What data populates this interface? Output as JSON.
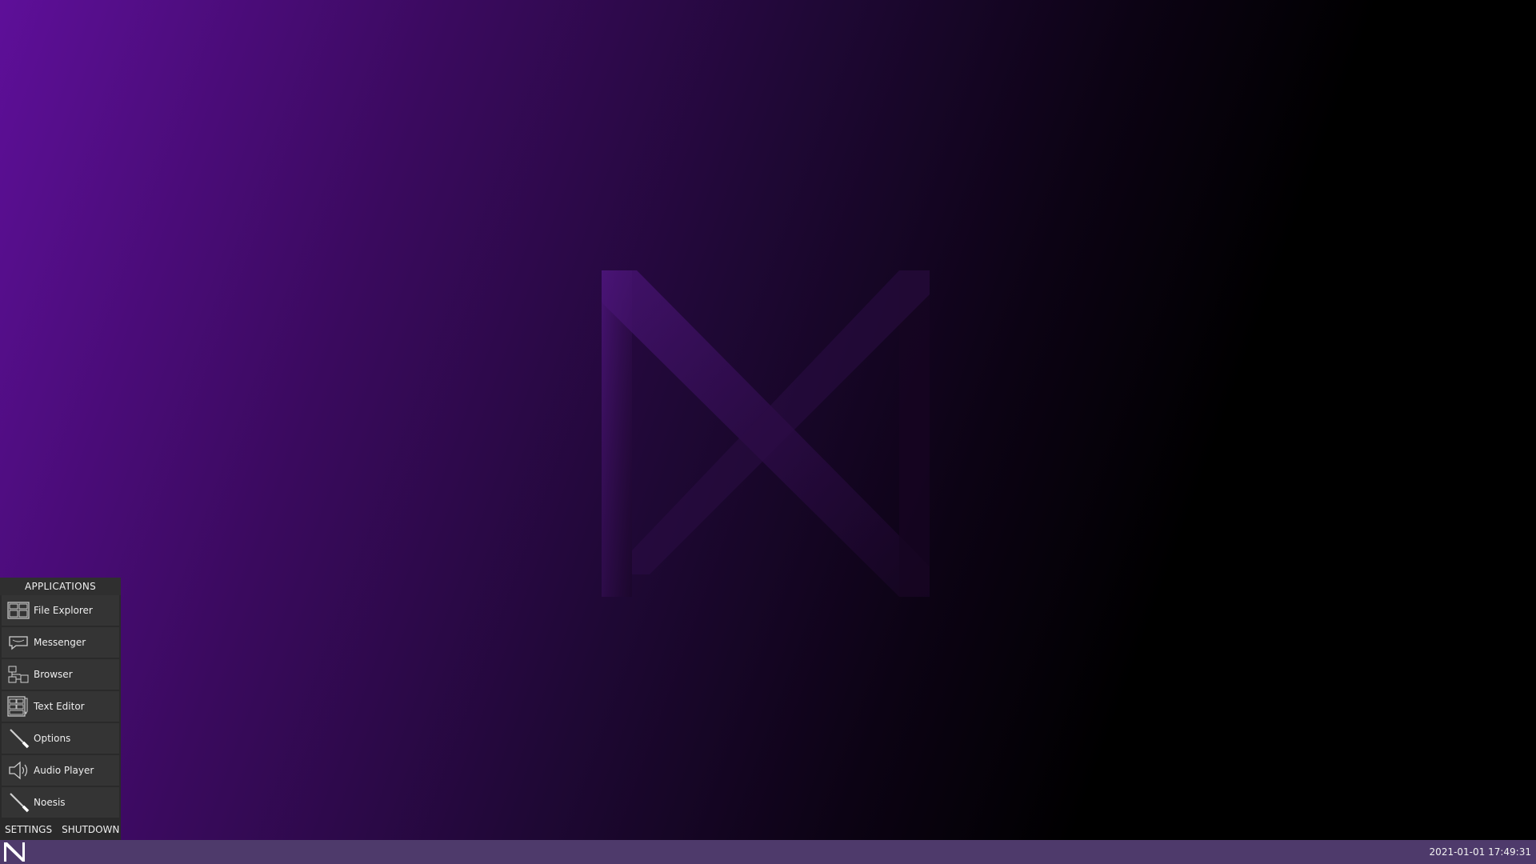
{
  "start_menu": {
    "header": "APPLICATIONS",
    "apps": [
      {
        "label": "File Explorer",
        "icon": "file-explorer-icon"
      },
      {
        "label": "Messenger",
        "icon": "messenger-icon"
      },
      {
        "label": "Browser",
        "icon": "browser-icon"
      },
      {
        "label": "Text Editor",
        "icon": "text-editor-icon"
      },
      {
        "label": "Options",
        "icon": "options-icon"
      },
      {
        "label": "Audio Player",
        "icon": "audio-player-icon"
      },
      {
        "label": "Noesis",
        "icon": "noesis-icon"
      }
    ],
    "settings_label": "SETTINGS",
    "shutdown_label": "SHUTDOWN"
  },
  "taskbar": {
    "clock": "2021-01-01 17:49:31"
  },
  "colors": {
    "taskbar": "#4e3a6b",
    "menu_bg": "#2a2a2a",
    "wallpaper_accent": "#5e0f99"
  }
}
